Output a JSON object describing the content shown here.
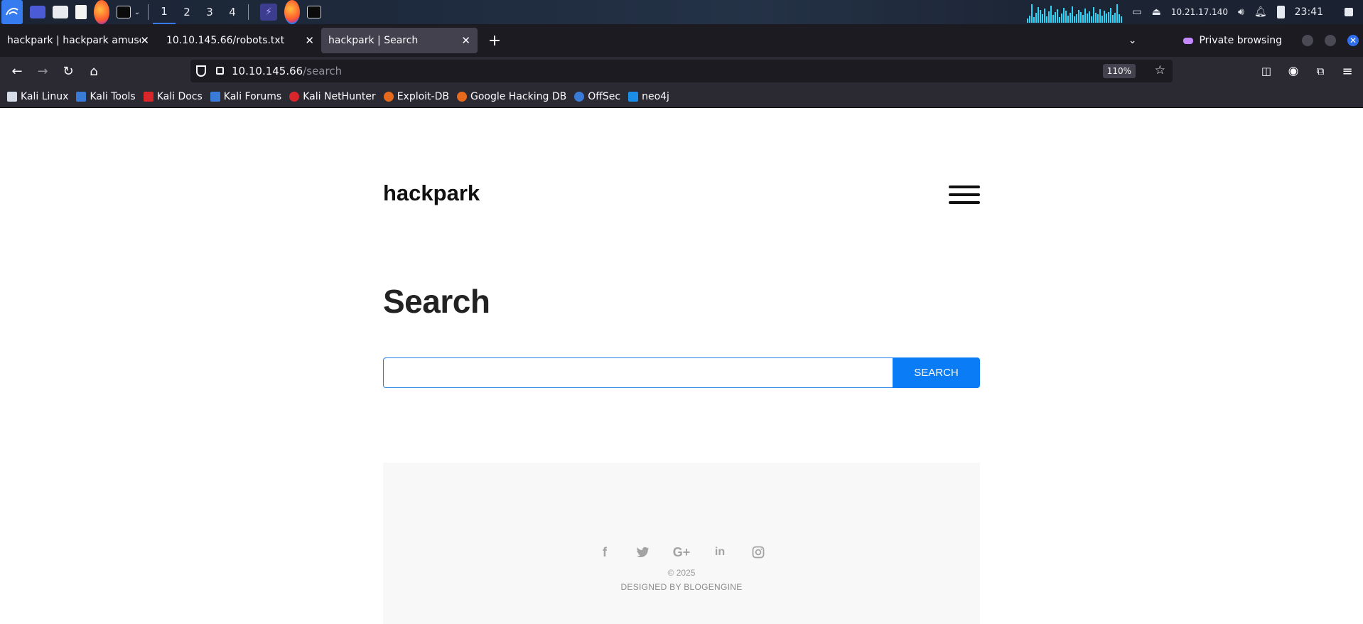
{
  "os_panel": {
    "workspaces": [
      "1",
      "2",
      "3",
      "4"
    ],
    "active_workspace": "1",
    "ip_address": "10.21.17.140",
    "clock": "23:41",
    "icons": [
      "kali-menu-icon",
      "desktop-icon",
      "file-manager-icon",
      "text-editor-icon",
      "firefox-icon",
      "terminal-icon",
      "burp-icon",
      "firefox-window-icon",
      "terminal-window-icon",
      "display-icon",
      "vpn-icon",
      "volume-icon",
      "bell-icon",
      "battery-icon",
      "lock-icon"
    ]
  },
  "browser": {
    "tabs": [
      {
        "title": "hackpark | hackpark amusem",
        "selected": false
      },
      {
        "title": "10.10.145.66/robots.txt",
        "selected": false
      },
      {
        "title": "hackpark | Search",
        "selected": true
      }
    ],
    "private_label": "Private browsing",
    "url_host": "10.10.145.66",
    "url_path": "/search",
    "zoom": "110%",
    "bookmarks": [
      {
        "label": "Kali Linux",
        "color": "#d7dde8"
      },
      {
        "label": "Kali Tools",
        "color": "#3b7bd8"
      },
      {
        "label": "Kali Docs",
        "color": "#d9262b"
      },
      {
        "label": "Kali Forums",
        "color": "#3b7bd8"
      },
      {
        "label": "Kali NetHunter",
        "color": "#d9262b"
      },
      {
        "label": "Exploit-DB",
        "color": "#e66a1e"
      },
      {
        "label": "Google Hacking DB",
        "color": "#e66a1e"
      },
      {
        "label": "OffSec",
        "color": "#3b7bd8"
      },
      {
        "label": "neo4j",
        "color": "#1a8ee6"
      }
    ]
  },
  "site": {
    "title": "hackpark",
    "heading": "Search",
    "search_value": "",
    "search_button": "SEARCH",
    "accent_color": "#0a7cf6",
    "social_icons": [
      "facebook-icon",
      "twitter-icon",
      "google-plus-icon",
      "linkedin-icon",
      "instagram-icon"
    ],
    "copyright": "© 2025",
    "designed_by": "DESIGNED BY BLOGENGINE"
  }
}
